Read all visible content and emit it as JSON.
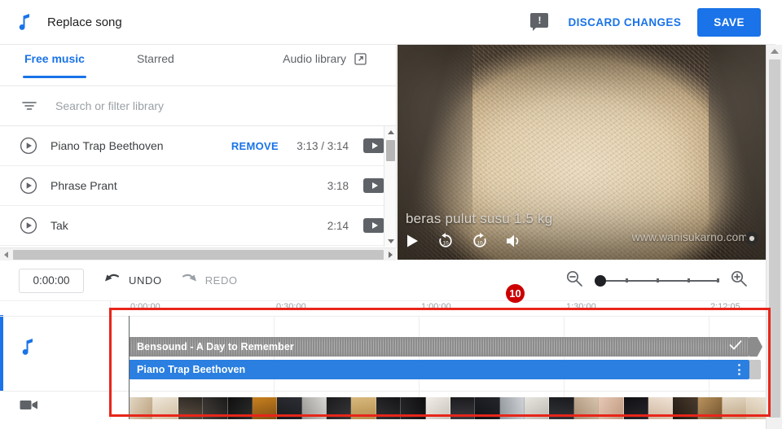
{
  "header": {
    "icon": "music-note-icon",
    "title": "Replace song",
    "feedback_icon": "feedback-exclamation-icon",
    "feedback_glyph": "!",
    "discard_label": "DISCARD CHANGES",
    "save_label": "SAVE",
    "accent_blue": "#1a73e8"
  },
  "library": {
    "tabs": [
      {
        "label": "Free music",
        "active": true
      },
      {
        "label": "Starred",
        "active": false
      }
    ],
    "audio_library_label": "Audio library",
    "audio_library_icon": "external-link-icon",
    "filter_icon": "filter-icon",
    "search": {
      "placeholder": "Search or filter library",
      "value": ""
    },
    "songs": [
      {
        "play_icon": "play-circle-icon",
        "name": "Piano Trap Beethoven",
        "action": "REMOVE",
        "duration": "3:13 / 3:14",
        "badge": "youtube-badge"
      },
      {
        "play_icon": "play-circle-icon",
        "name": "Phrase Prant",
        "action": "",
        "duration": "3:18",
        "badge": "youtube-badge"
      },
      {
        "play_icon": "play-circle-icon",
        "name": "Tak",
        "action": "",
        "duration": "2:14",
        "badge": "youtube-badge"
      }
    ]
  },
  "video": {
    "caption": "beras pulut susu 1.5 kg",
    "watermark": "www.wanisukarno.com",
    "controls": [
      {
        "name": "play-icon"
      },
      {
        "name": "replay-10-icon",
        "label": "10"
      },
      {
        "name": "forward-10-icon",
        "label": "10"
      },
      {
        "name": "volume-icon"
      }
    ],
    "settings_icon": "gear-icon"
  },
  "toolbar": {
    "current_time": "0:00:00",
    "undo_label": "UNDO",
    "undo_icon": "undo-arrow-icon",
    "redo_label": "REDO",
    "redo_icon": "redo-arrow-icon",
    "zoom_out_icon": "zoom-out-icon",
    "zoom_in_icon": "zoom-in-icon",
    "zoom_level": 0,
    "zoom_ticks": 4
  },
  "timeline": {
    "gutter": [
      {
        "icon": "music-note-icon",
        "name": "audio-track-header"
      },
      {
        "icon": "video-camera-icon",
        "name": "video-track-header"
      }
    ],
    "ruler_labels": [
      "0:00:00",
      "0:30:00",
      "1:00:00",
      "1:30:00",
      "2:12:05"
    ],
    "playhead_time": "0:00:00",
    "clips": [
      {
        "label": "Bensound - A Day to Remember",
        "color": "#8c8c8c",
        "state_icon": "check-icon"
      },
      {
        "label": "Piano Trap Beethoven",
        "color": "#2a7fe0",
        "state_icon": "more-vert-icon"
      }
    ]
  },
  "annotation": {
    "badge_number": "10",
    "badge_color": "#cc0000",
    "rect_color": "#e8251a"
  }
}
